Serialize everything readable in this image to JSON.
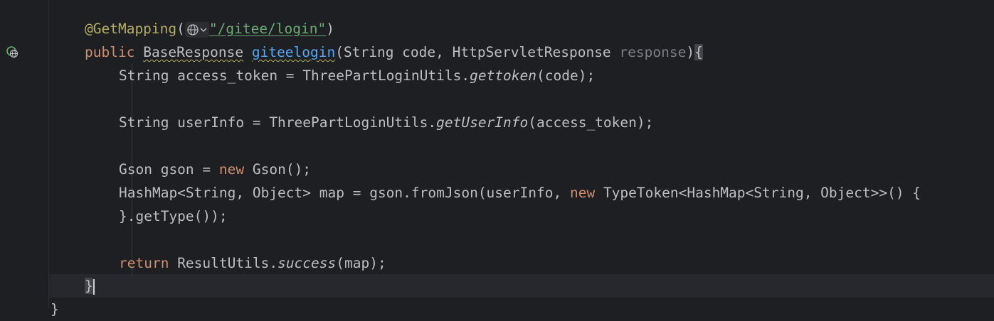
{
  "editor": {
    "lines": [
      {
        "annotation": "@GetMapping",
        "open_paren": "(",
        "string": "\"/gitee/login\"",
        "close_paren": ")"
      },
      {
        "kw_public": "public",
        "type": "BaseResponse",
        "method": "giteelogin",
        "params_start": "(String code, HttpServletResponse ",
        "param_unused": "response",
        "params_end": ")",
        "brace": "{"
      },
      {
        "prefix": "String access_token = ThreePartLoginUtils.",
        "call": "gettoken",
        "suffix": "(code);"
      },
      {
        "prefix": "String userInfo = ThreePartLoginUtils.",
        "call": "getUserInfo",
        "suffix": "(access_token);"
      },
      {
        "prefix": "Gson gson = ",
        "kw_new": "new",
        "suffix": " Gson();"
      },
      {
        "prefix": "HashMap<String, Object> map = gson.fromJson(userInfo, ",
        "kw_new": "new",
        "suffix": " TypeToken<HashMap<String, Object>>() {"
      },
      {
        "text": "}.getType());"
      },
      {
        "kw_return": "return",
        "prefix": " ResultUtils.",
        "call": "success",
        "suffix": "(map);"
      },
      {
        "brace": "}"
      },
      {
        "brace": "}"
      }
    ]
  },
  "icons": {
    "gutter": "web-endpoint-icon",
    "inlay": "globe-dropdown-icon"
  },
  "colors": {
    "background": "#1e1f22",
    "keyword": "#cf8e6d",
    "annotation": "#b3ae60",
    "string": "#6aab73",
    "method": "#56a8f5",
    "text": "#bcbec4"
  }
}
